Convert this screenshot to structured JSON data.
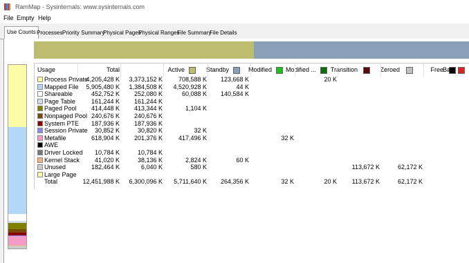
{
  "window": {
    "title": "RamMap - Sysinternals: www.sysinternals.com",
    "icon_colors": [
      "#c0392b",
      "#3a7bd5",
      "#6ab04c",
      "#8e44ad",
      "#e67e22"
    ]
  },
  "menu": [
    "File",
    "Empty",
    "Help"
  ],
  "tabs": [
    "Use Counts",
    "Processes",
    "Priority Summary",
    "Physical Pages",
    "Physical Ranges",
    "File Summary",
    "File Details"
  ],
  "active_tab": "Use Counts",
  "overview_bar": [
    {
      "label": "Active",
      "color": "#bebc6e",
      "fraction": 0.5059
    },
    {
      "label": "Standby",
      "color": "#87a0b8",
      "fraction": 0.4941
    }
  ],
  "mini_bar": [
    {
      "color": "#fcfca8",
      "fraction": 0.3375
    },
    {
      "color": "#b3d7f7",
      "fraction": 0.4743
    },
    {
      "color": "#fcfcfc",
      "fraction": 0.0364
    },
    {
      "color": "#cfdde8",
      "fraction": 0.013
    },
    {
      "color": "#808000",
      "fraction": 0.0333
    },
    {
      "color": "#7a4a0a",
      "fraction": 0.0193
    },
    {
      "color": "#8b0000",
      "fraction": 0.0151
    },
    {
      "color": "#8a8ae0",
      "fraction": 0.0025
    },
    {
      "color": "#f49bc8",
      "fraction": 0.0497
    },
    {
      "color": "#777777",
      "fraction": 0.0009
    },
    {
      "color": "#f5b080",
      "fraction": 0.0033
    },
    {
      "color": "#cccccc",
      "fraction": 0.0147
    }
  ],
  "table": {
    "headers": [
      "Usage",
      "Total",
      "Active",
      "Standby",
      "Modified",
      "Modified ...",
      "Transition",
      "Zeroed",
      "Free",
      "Bad"
    ],
    "header_swatches": [
      null,
      null,
      "#bebc6e",
      "#87a0b8",
      "#1fbf1f",
      "#0a6e0a",
      "#5a0a0a",
      "#c0c0c0",
      "#000000",
      "#e02020"
    ],
    "rows": [
      {
        "label": "Process Private",
        "swatch": "#fcfca8",
        "cells": [
          "4,205,428 K",
          "3,373,152 K",
          "708,588 K",
          "123,668 K",
          "",
          "20 K",
          "",
          "",
          ""
        ]
      },
      {
        "label": "Mapped File",
        "swatch": "#b3d7f7",
        "cells": [
          "5,905,480 K",
          "1,384,508 K",
          "4,520,928 K",
          "44 K",
          "",
          "",
          "",
          "",
          ""
        ]
      },
      {
        "label": "Shareable",
        "swatch": "#fcfcfc",
        "cells": [
          "452,752 K",
          "252,080 K",
          "60,088 K",
          "140,584 K",
          "",
          "",
          "",
          "",
          ""
        ]
      },
      {
        "label": "Page Table",
        "swatch": "#cfdde8",
        "cells": [
          "161,244 K",
          "161,244 K",
          "",
          "",
          "",
          "",
          "",
          "",
          ""
        ]
      },
      {
        "label": "Paged Pool",
        "swatch": "#808000",
        "cells": [
          "414,448 K",
          "413,344 K",
          "1,104 K",
          "",
          "",
          "",
          "",
          "",
          ""
        ]
      },
      {
        "label": "Nonpaged Pool",
        "swatch": "#7a4a0a",
        "cells": [
          "240,676 K",
          "240,676 K",
          "",
          "",
          "",
          "",
          "",
          "",
          ""
        ]
      },
      {
        "label": "System PTE",
        "swatch": "#8b0000",
        "cells": [
          "187,936 K",
          "187,936 K",
          "",
          "",
          "",
          "",
          "",
          "",
          ""
        ]
      },
      {
        "label": "Session Private",
        "swatch": "#8a8ae0",
        "cells": [
          "30,852 K",
          "30,820 K",
          "32 K",
          "",
          "",
          "",
          "",
          "",
          ""
        ]
      },
      {
        "label": "Metafile",
        "swatch": "#f49bc8",
        "cells": [
          "618,904 K",
          "201,376 K",
          "417,496 K",
          "",
          "32 K",
          "",
          "",
          "",
          ""
        ]
      },
      {
        "label": "AWE",
        "swatch": "#000000",
        "cells": [
          "",
          "",
          "",
          "",
          "",
          "",
          "",
          "",
          ""
        ]
      },
      {
        "label": "Driver Locked",
        "swatch": "#777777",
        "cells": [
          "10,784 K",
          "10,784 K",
          "",
          "",
          "",
          "",
          "",
          "",
          ""
        ]
      },
      {
        "label": "Kernel Stack",
        "swatch": "#f5b080",
        "cells": [
          "41,020 K",
          "38,136 K",
          "2,824 K",
          "60 K",
          "",
          "",
          "",
          "",
          ""
        ]
      },
      {
        "label": "Unused",
        "swatch": "#cccccc",
        "cells": [
          "182,464 K",
          "6,040 K",
          "580 K",
          "",
          "",
          "",
          "113,672 K",
          "62,172 K",
          ""
        ]
      },
      {
        "label": "Large Page",
        "swatch": "#fcfca8",
        "cells": [
          "",
          "",
          "",
          "",
          "",
          "",
          "",
          "",
          ""
        ]
      },
      {
        "label": "Total",
        "swatch": null,
        "cells": [
          "12,451,988 K",
          "6,300,096 K",
          "5,711,640 K",
          "264,356 K",
          "32 K",
          "20 K",
          "113,672 K",
          "62,172 K",
          ""
        ]
      }
    ]
  }
}
